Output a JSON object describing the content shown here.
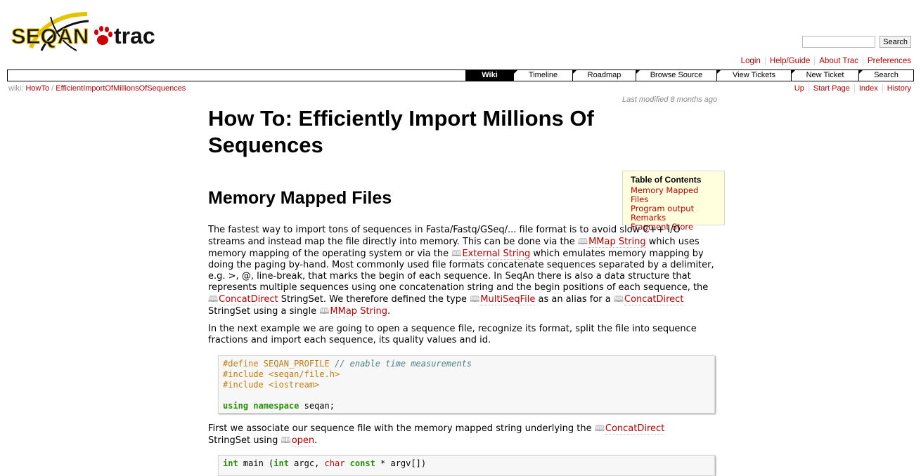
{
  "header": {
    "logo": {
      "brand": "SEQAN",
      "product": "trac"
    },
    "search": {
      "placeholder": "",
      "button": "Search"
    }
  },
  "metanav": [
    "Login",
    "Help/Guide",
    "About Trac",
    "Preferences"
  ],
  "mainnav": [
    "Wiki",
    "Timeline",
    "Roadmap",
    "Browse Source",
    "View Tickets",
    "New Ticket",
    "Search"
  ],
  "breadcrumb": {
    "prefix": "wiki:",
    "parts": [
      "HowTo",
      "/",
      "EfficientImportOfMillionsOfSequences"
    ]
  },
  "ctxtnav": [
    "Up",
    "Start Page",
    "Index",
    "History"
  ],
  "last_modified": "Last modified 8 months ago",
  "page": {
    "title": "How To: Efficiently Import Millions Of Sequences",
    "section1": "Memory Mapped Files",
    "toc": {
      "heading": "Table of Contents",
      "items": [
        "Memory Mapped Files",
        "Program output",
        "Remarks",
        "Fragment Store"
      ]
    },
    "p1": {
      "t1": "The fastest way to import tons of sequences in Fasta/Fastq/GSeq/... file format is to avoid slow C++ I/O streams and instead map the file directly into memory. This can be done via the ",
      "l1": "MMap String",
      "t2": " which uses memory mapping of the operating system or via the ",
      "l2": "External String",
      "t3": " which emulates memory mapping by doing the paging by-hand. Most commonly used file formats concatenate sequences separated by a delimiter, e.g. >, @, line-break, that marks the begin of each sequence. In SeqAn there is also a data structure that represents multiple sequences using one concatenation string and the begin positions of each sequence, the ",
      "l3": "ConcatDirect",
      "t4": " StringSet. We therefore defined the type ",
      "l4": "MultiSeqFile",
      "t5": " as an alias for a ",
      "l5": "ConcatDirect",
      "t6": " StringSet using a single ",
      "l6": "MMap String",
      "t7": "."
    },
    "p2": "In the next example we are going to open a sequence file, recognize its format, split the file into sequence fractions and import each sequence, its quality values and id.",
    "code1": {
      "l1_pre": "#define SEQAN_PROFILE",
      "l1_cm": " // enable time measurements",
      "l2": "#include <seqan/file.h>",
      "l3": "#include <iostream>",
      "l5_kw1": "using",
      "l5_kw2": "namespace",
      "l5_rest": " seqan;"
    },
    "p3": {
      "t1": "First we associate our sequence file with the memory mapped string underlying the ",
      "l1": "ConcatDirect",
      "t2": "StringSet using ",
      "l2": "open",
      "t3": "."
    },
    "code2": {
      "kw1": "int",
      "t1": " main (",
      "kw2": "int",
      "t2": " argc, ",
      "ty1": "char",
      "t3": " ",
      "kw3": "const",
      "t4": " * argv[])"
    }
  },
  "colors": {
    "link": "#bb0000",
    "toc_bg": "#ffffdd",
    "nav_active": "#000000"
  }
}
